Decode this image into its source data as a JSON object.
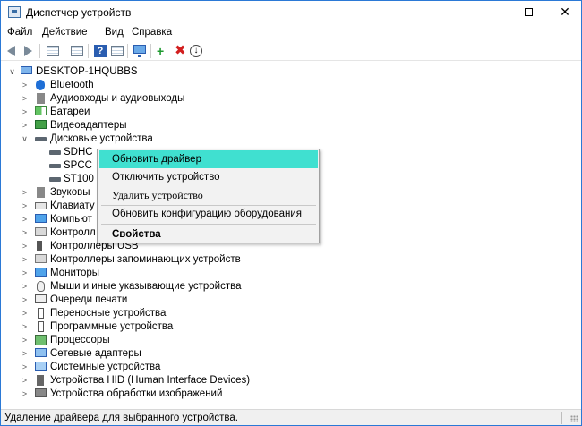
{
  "window": {
    "title": "Диспетчер устройств",
    "controls": {
      "minimize": "—",
      "close": "✕"
    }
  },
  "menu": [
    "Файл",
    "Действие",
    "Вид",
    "Справка"
  ],
  "toolbar": {
    "icons": [
      "back-icon",
      "forward-icon",
      "properties-icon",
      "list-icon",
      "help-icon",
      "monitor-icon",
      "add-driver-icon",
      "remove-icon",
      "update-icon"
    ],
    "help_glyph": "?",
    "add_glyph": "+",
    "remove_glyph": "✖",
    "update_glyph": "↓"
  },
  "tree": {
    "root": {
      "label": "DESKTOP-1HQUBBS",
      "expander": "∨"
    },
    "categories": [
      {
        "label": "Bluetooth",
        "icon": "bluetooth-icon",
        "expander": ">"
      },
      {
        "label": "Аудиовходы и аудиовыходы",
        "icon": "audio-icon",
        "expander": ">"
      },
      {
        "label": "Батареи",
        "icon": "battery-icon",
        "expander": ">"
      },
      {
        "label": "Видеоадаптеры",
        "icon": "display-adapter-icon",
        "expander": ">"
      },
      {
        "label": "Дисковые устройства",
        "icon": "disk-drive-icon",
        "expander": "∨"
      }
    ],
    "disks": [
      {
        "label": "SDHC",
        "icon": "disk-icon"
      },
      {
        "label": "SPCC",
        "icon": "disk-icon"
      },
      {
        "label": "ST100",
        "icon": "disk-icon"
      }
    ],
    "more_categories": [
      {
        "label": "Звуковы",
        "icon": "sound-icon",
        "expander": ">"
      },
      {
        "label": "Клавиату",
        "icon": "keyboard-icon",
        "expander": ">"
      },
      {
        "label": "Компьют",
        "icon": "computer-icon",
        "expander": ">"
      },
      {
        "label": "Контролл",
        "icon": "controller-icon",
        "expander": ">"
      },
      {
        "label": "Контроллеры USB",
        "icon": "usb-icon",
        "expander": ">"
      },
      {
        "label": "Контроллеры запоминающих устройств",
        "icon": "storage-controller-icon",
        "expander": ">"
      },
      {
        "label": "Мониторы",
        "icon": "monitor-icon",
        "expander": ">"
      },
      {
        "label": "Мыши и иные указывающие устройства",
        "icon": "mouse-icon",
        "expander": ">"
      },
      {
        "label": "Очереди печати",
        "icon": "printer-icon",
        "expander": ">"
      },
      {
        "label": "Переносные устройства",
        "icon": "portable-device-icon",
        "expander": ">"
      },
      {
        "label": "Программные устройства",
        "icon": "software-device-icon",
        "expander": ">"
      },
      {
        "label": "Процессоры",
        "icon": "processor-icon",
        "expander": ">"
      },
      {
        "label": "Сетевые адаптеры",
        "icon": "network-adapter-icon",
        "expander": ">"
      },
      {
        "label": "Системные устройства",
        "icon": "system-device-icon",
        "expander": ">"
      },
      {
        "label": "Устройства HID (Human Interface Devices)",
        "icon": "hid-icon",
        "expander": ">"
      },
      {
        "label": "Устройства обработки изображений",
        "icon": "imaging-device-icon",
        "expander": ">"
      }
    ]
  },
  "context_menu": {
    "items": [
      {
        "label": "Обновить драйвер",
        "highlighted": true
      },
      {
        "label": "Отключить устройство"
      },
      {
        "label": "Удалить устройство"
      },
      {
        "label": "Обновить конфигурацию оборудования"
      },
      {
        "label": "Свойства",
        "bold": true
      }
    ],
    "highlight_color": "#40E0D0"
  },
  "status_bar": {
    "text": "Удаление драйвера для выбранного устройства."
  }
}
